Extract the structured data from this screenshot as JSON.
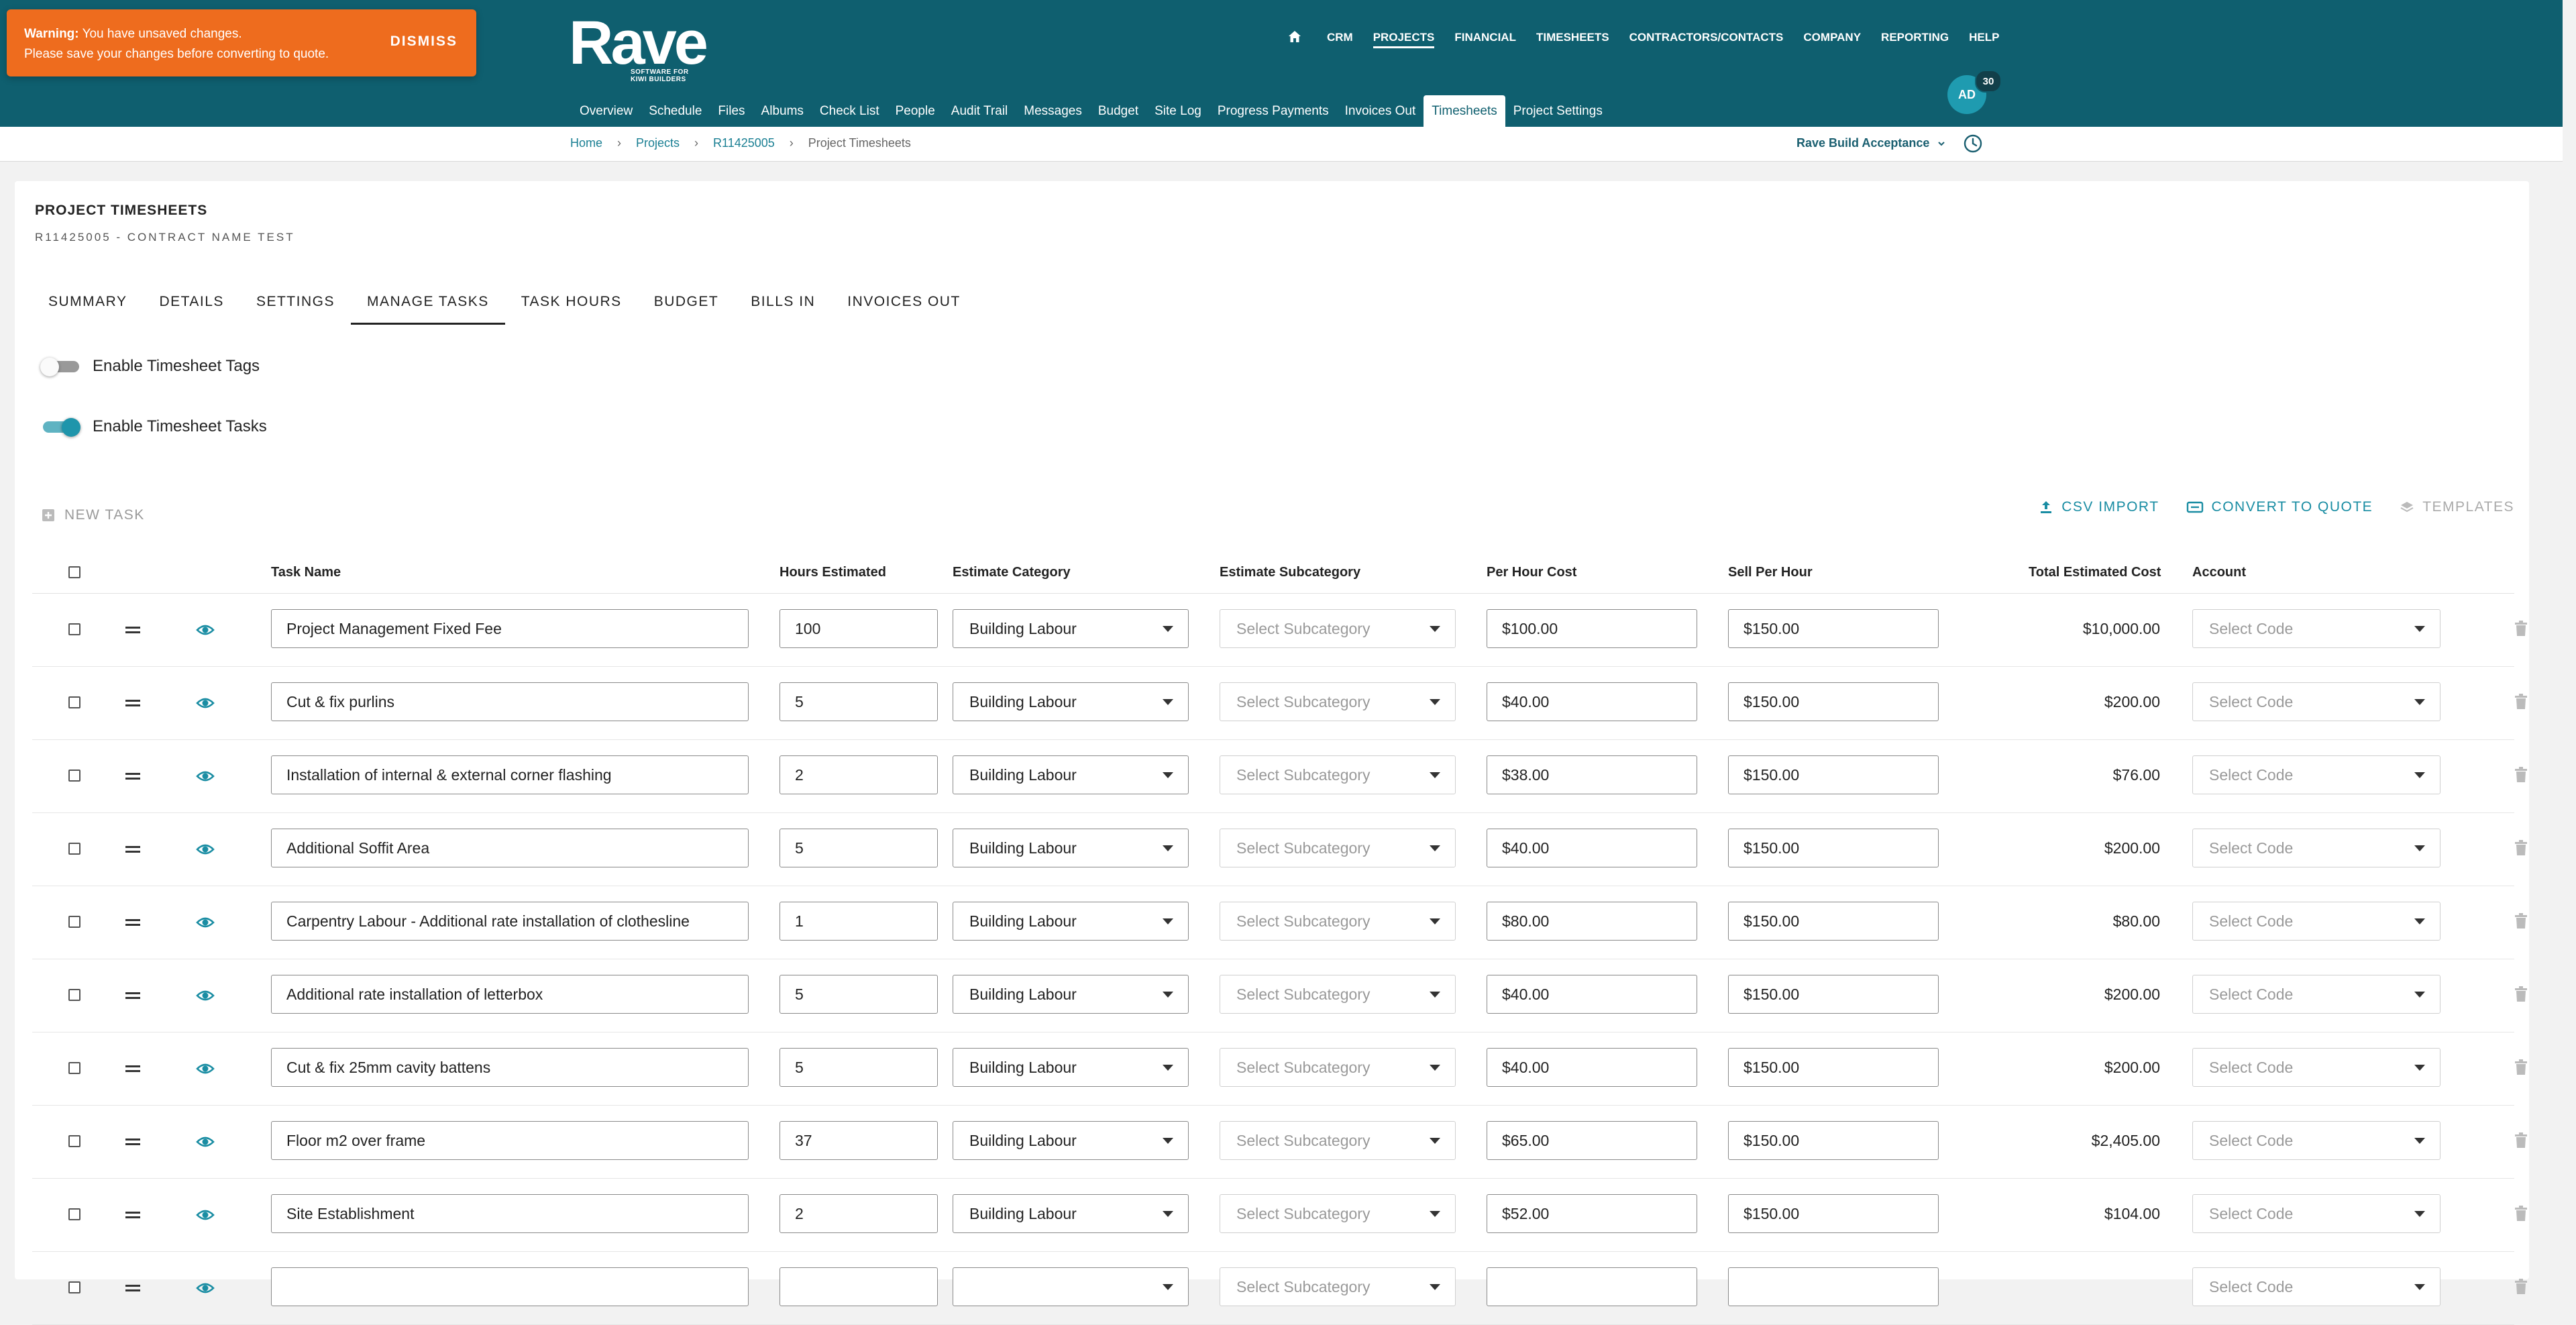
{
  "app": {
    "logo_word": "Rave",
    "logo_tagline": "SOFTWARE FOR KIWI BUILDERS"
  },
  "toast": {
    "label": "Warning:",
    "line1": "You have unsaved changes.",
    "line2": "Please save your changes before converting to quote.",
    "dismiss": "DISMISS"
  },
  "topnav": [
    "CRM",
    "PROJECTS",
    "FINANCIAL",
    "TIMESHEETS",
    "CONTRACTORS/CONTACTS",
    "COMPANY",
    "REPORTING",
    "HELP"
  ],
  "topnav_active": "PROJECTS",
  "user": {
    "initials": "AD",
    "notifications": "30"
  },
  "subnav": [
    "Overview",
    "Schedule",
    "Files",
    "Albums",
    "Check List",
    "People",
    "Audit Trail",
    "Messages",
    "Budget",
    "Site Log",
    "Progress Payments",
    "Invoices Out",
    "Timesheets",
    "Project Settings"
  ],
  "subnav_active": "Timesheets",
  "breadcrumb": [
    "Home",
    "Projects",
    "R11425005",
    "Project Timesheets"
  ],
  "entity_selector": "Rave Build Acceptance",
  "page": {
    "title": "PROJECT TIMESHEETS",
    "subtitle": "R11425005 - CONTRACT NAME TEST"
  },
  "tabs": [
    "SUMMARY",
    "DETAILS",
    "SETTINGS",
    "MANAGE TASKS",
    "TASK HOURS",
    "BUDGET",
    "BILLS IN",
    "INVOICES OUT"
  ],
  "tab_active": "MANAGE TASKS",
  "toggles": [
    {
      "label": "Enable Timesheet Tags",
      "on": false
    },
    {
      "label": "Enable Timesheet Tasks",
      "on": true
    }
  ],
  "toolbar": {
    "new_task": "NEW TASK",
    "csv_import": "CSV IMPORT",
    "convert_to_quote": "CONVERT TO QUOTE",
    "templates": "TEMPLATES"
  },
  "columns": {
    "task_name": "Task Name",
    "hours_estimated": "Hours Estimated",
    "estimate_category": "Estimate Category",
    "estimate_subcategory": "Estimate Subcategory",
    "per_hour_cost": "Per Hour Cost",
    "sell_per_hour": "Sell Per Hour",
    "total_estimated_cost": "Total Estimated Cost",
    "account": "Account"
  },
  "placeholders": {
    "subcategory": "Select Subcategory",
    "account": "Select Code"
  },
  "rows": [
    {
      "task": "Project Management Fixed Fee",
      "hours": "100",
      "category": "Building Labour",
      "cost": "$100.00",
      "sell": "$150.00",
      "total": "$10,000.00"
    },
    {
      "task": "Cut & fix purlins",
      "hours": "5",
      "category": "Building Labour",
      "cost": "$40.00",
      "sell": "$150.00",
      "total": "$200.00"
    },
    {
      "task": "Installation of internal & external corner flashing",
      "hours": "2",
      "category": "Building Labour",
      "cost": "$38.00",
      "sell": "$150.00",
      "total": "$76.00"
    },
    {
      "task": "Additional Soffit Area",
      "hours": "5",
      "category": "Building Labour",
      "cost": "$40.00",
      "sell": "$150.00",
      "total": "$200.00"
    },
    {
      "task": "Carpentry Labour - Additional rate installation of clothesline",
      "hours": "1",
      "category": "Building Labour",
      "cost": "$80.00",
      "sell": "$150.00",
      "total": "$80.00"
    },
    {
      "task": "Additional rate installation of letterbox",
      "hours": "5",
      "category": "Building Labour",
      "cost": "$40.00",
      "sell": "$150.00",
      "total": "$200.00"
    },
    {
      "task": "Cut & fix 25mm cavity battens",
      "hours": "5",
      "category": "Building Labour",
      "cost": "$40.00",
      "sell": "$150.00",
      "total": "$200.00"
    },
    {
      "task": "Floor m2 over frame",
      "hours": "37",
      "category": "Building Labour",
      "cost": "$65.00",
      "sell": "$150.00",
      "total": "$2,405.00"
    },
    {
      "task": "Site Establishment",
      "hours": "2",
      "category": "Building Labour",
      "cost": "$52.00",
      "sell": "$150.00",
      "total": "$104.00"
    },
    {
      "task": "",
      "hours": "",
      "category": "",
      "cost": "",
      "sell": "",
      "total": ""
    }
  ],
  "colors": {
    "header": "#0f5f6f",
    "accent": "#1a8da3",
    "warning": "#ee6c1e"
  }
}
